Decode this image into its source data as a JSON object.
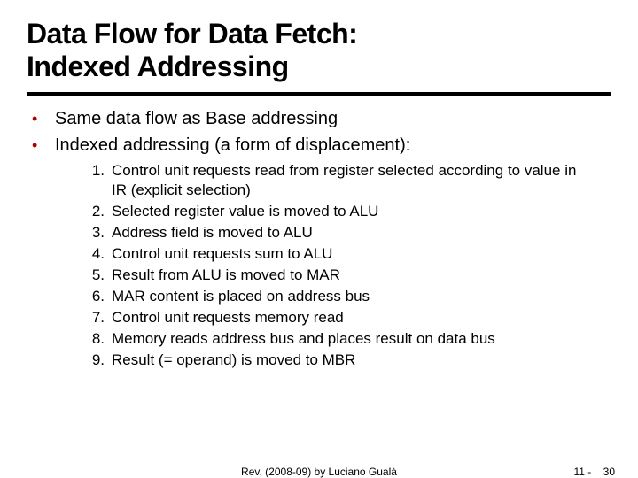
{
  "title_line1": "Data Flow for Data Fetch:",
  "title_line2": "Indexed Addressing",
  "bullets": [
    "Same data flow as Base addressing",
    "Indexed addressing (a form of displacement):"
  ],
  "steps": [
    "Control unit requests read from register selected according to value in IR (explicit selection)",
    "Selected register value is moved to ALU",
    "Address field is moved to ALU",
    "Control unit requests sum to ALU",
    "Result from ALU is moved to MAR",
    "MAR content is placed on address bus",
    "Control unit requests memory read",
    "Memory reads address bus and places result on data bus",
    "Result (= operand) is moved to MBR"
  ],
  "footer": {
    "revision": "Rev. (2008-09) by Luciano Gualà",
    "page_prefix": "11 -",
    "page_number": "30"
  }
}
